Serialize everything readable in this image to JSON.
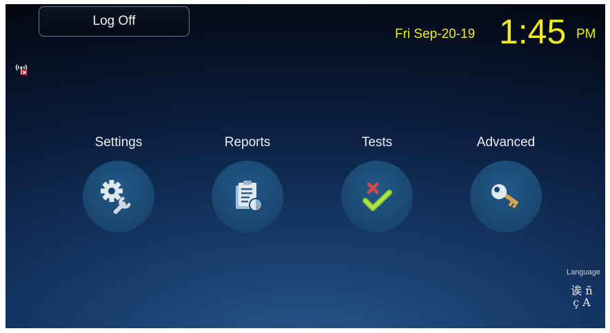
{
  "header": {
    "logoff_label": "Log Off",
    "date": "Fri Sep-20-19",
    "time": "1:45",
    "ampm": "PM"
  },
  "status": {
    "wireless_icon": "wireless-disconnected-icon"
  },
  "menu": [
    {
      "label": "Settings",
      "icon": "settings-icon"
    },
    {
      "label": "Reports",
      "icon": "reports-icon"
    },
    {
      "label": "Tests",
      "icon": "tests-icon"
    },
    {
      "label": "Advanced",
      "icon": "key-icon"
    }
  ],
  "language": {
    "label": "Language",
    "glyph_line1": "诶 ñ",
    "glyph_line2": "ç A"
  },
  "colors": {
    "clock": "#f2ec16",
    "background": "#0a1c3c",
    "circle": "#19466f"
  }
}
